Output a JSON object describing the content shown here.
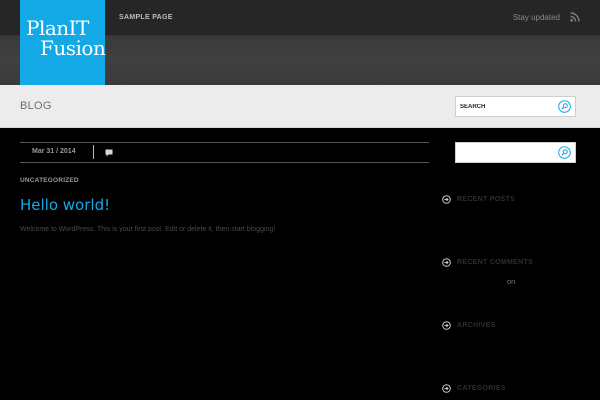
{
  "brand": {
    "logo_line1": "PlanIT",
    "logo_line2": "Fusion"
  },
  "nav": {
    "items": [
      {
        "label": "SAMPLE PAGE"
      }
    ]
  },
  "header": {
    "stay_updated": "Stay updated",
    "rss_icon": "rss-icon"
  },
  "band": {
    "title": "BLOG",
    "search_placeholder": "SEARCH"
  },
  "sidebar_search": {
    "placeholder": ""
  },
  "post": {
    "date": "Mar 31 / 2014",
    "category": "UNCATEGORIZED",
    "title": "Hello world!",
    "excerpt": "Welcome to WordPress. This is your first post. Edit or delete it, then start blogging!"
  },
  "widgets": {
    "recent_posts": "RECENT POSTS",
    "recent_comments": "RECENT COMMENTS",
    "comments_on": "on",
    "archives": "ARCHIVES",
    "categories": "CATEGORIES"
  },
  "colors": {
    "accent": "#12a9e6",
    "background": "#000000",
    "band": "#ececec"
  }
}
